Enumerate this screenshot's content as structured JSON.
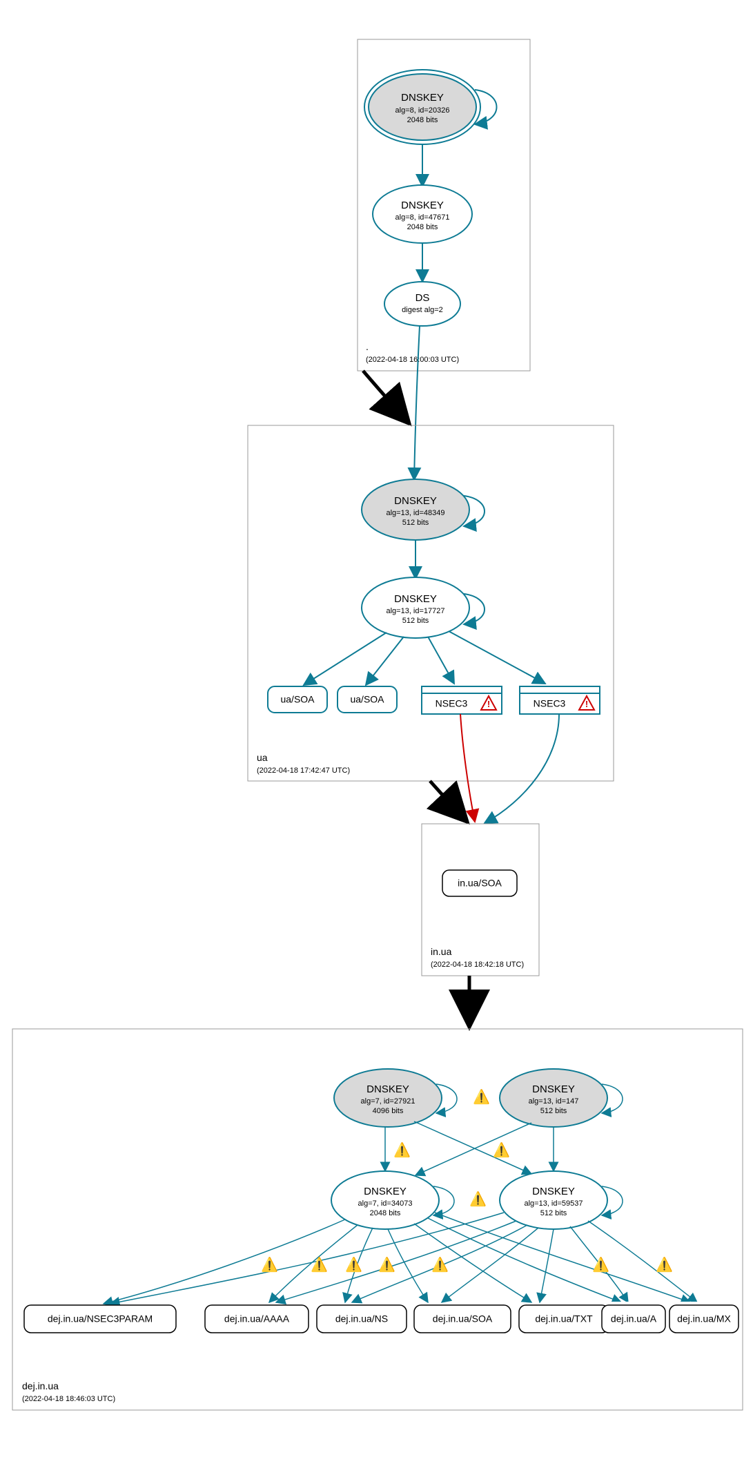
{
  "zones": {
    "root": {
      "name": ".",
      "timestamp": "(2022-04-18 16:00:03 UTC)"
    },
    "ua": {
      "name": "ua",
      "timestamp": "(2022-04-18 17:42:47 UTC)"
    },
    "inua": {
      "name": "in.ua",
      "timestamp": "(2022-04-18 18:42:18 UTC)"
    },
    "dej": {
      "name": "dej.in.ua",
      "timestamp": "(2022-04-18 18:46:03 UTC)"
    }
  },
  "nodes": {
    "root_ksk": {
      "title": "DNSKEY",
      "sub1": "alg=8, id=20326",
      "sub2": "2048 bits"
    },
    "root_zsk": {
      "title": "DNSKEY",
      "sub1": "alg=8, id=47671",
      "sub2": "2048 bits"
    },
    "root_ds": {
      "title": "DS",
      "sub1": "digest alg=2"
    },
    "ua_ksk": {
      "title": "DNSKEY",
      "sub1": "alg=13, id=48349",
      "sub2": "512 bits"
    },
    "ua_zsk": {
      "title": "DNSKEY",
      "sub1": "alg=13, id=17727",
      "sub2": "512 bits"
    },
    "ua_soa1": {
      "title": "ua/SOA"
    },
    "ua_soa2": {
      "title": "ua/SOA"
    },
    "ua_nsec1": {
      "title": "NSEC3"
    },
    "ua_nsec2": {
      "title": "NSEC3"
    },
    "inua_soa": {
      "title": "in.ua/SOA"
    },
    "dej_ksk1": {
      "title": "DNSKEY",
      "sub1": "alg=7, id=27921",
      "sub2": "4096 bits"
    },
    "dej_ksk2": {
      "title": "DNSKEY",
      "sub1": "alg=13, id=147",
      "sub2": "512 bits"
    },
    "dej_zsk1": {
      "title": "DNSKEY",
      "sub1": "alg=7, id=34073",
      "sub2": "2048 bits"
    },
    "dej_zsk2": {
      "title": "DNSKEY",
      "sub1": "alg=13, id=59537",
      "sub2": "512 bits"
    },
    "rr1": {
      "title": "dej.in.ua/NSEC3PARAM"
    },
    "rr2": {
      "title": "dej.in.ua/AAAA"
    },
    "rr3": {
      "title": "dej.in.ua/NS"
    },
    "rr4": {
      "title": "dej.in.ua/SOA"
    },
    "rr5": {
      "title": "dej.in.ua/TXT"
    },
    "rr6": {
      "title": "dej.in.ua/A"
    },
    "rr7": {
      "title": "dej.in.ua/MX"
    }
  },
  "glyphs": {
    "warn_yellow": "⚠",
    "warn_red": "⚠"
  }
}
